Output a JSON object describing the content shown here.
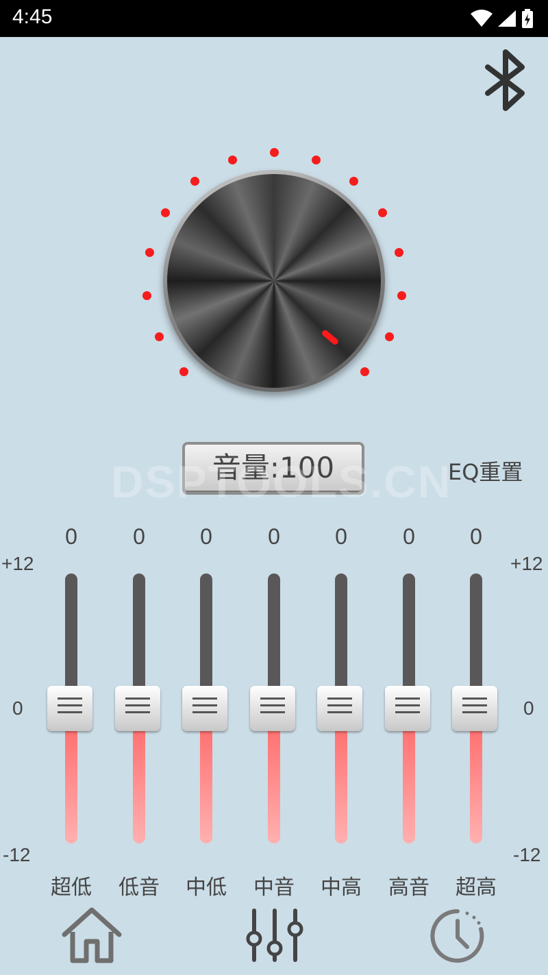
{
  "status": {
    "time": "4:45"
  },
  "icons": {
    "bluetooth": "bluetooth-icon",
    "home": "home-icon",
    "equalizer": "equalizer-icon",
    "timer": "timer-icon"
  },
  "colors": {
    "accent": "#f41d1d",
    "background": "#cbdde7"
  },
  "volume": {
    "label": "音量:100",
    "value": 100,
    "max": 100
  },
  "watermark": "DSPTOOLS.CN",
  "eq_reset_label": "EQ重置",
  "scale": {
    "top": "+12",
    "mid": "0",
    "bottom": "-12"
  },
  "bands": [
    {
      "label": "超低",
      "value": "0"
    },
    {
      "label": "低音",
      "value": "0"
    },
    {
      "label": "中低",
      "value": "0"
    },
    {
      "label": "中音",
      "value": "0"
    },
    {
      "label": "中高",
      "value": "0"
    },
    {
      "label": "高音",
      "value": "0"
    },
    {
      "label": "超高",
      "value": "0"
    }
  ]
}
